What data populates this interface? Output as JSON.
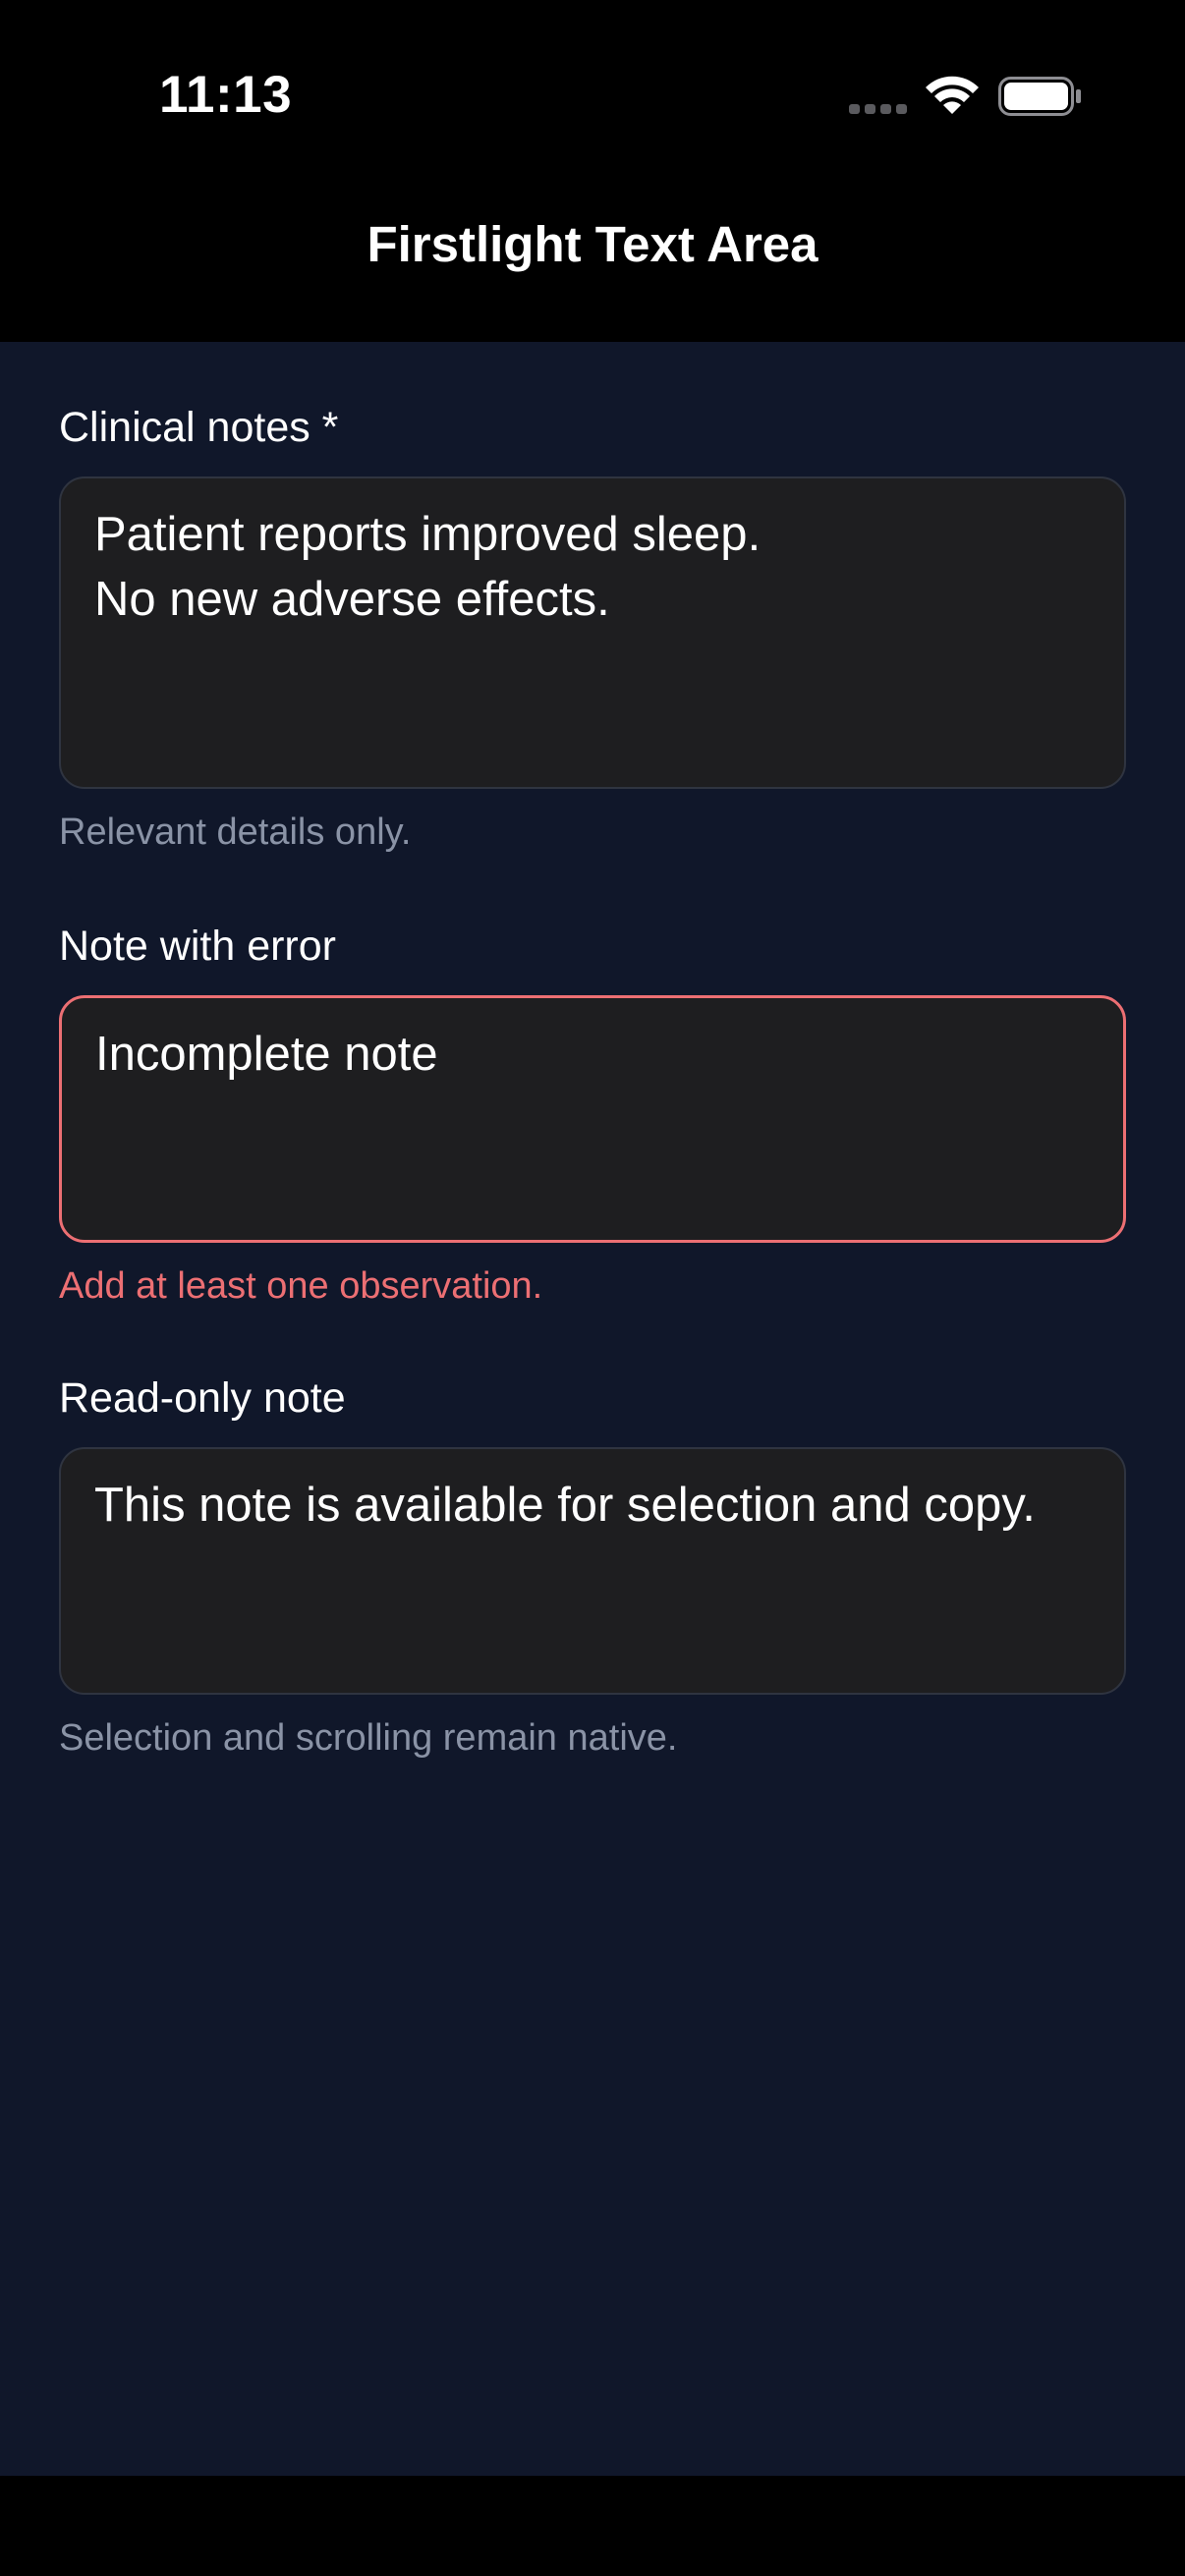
{
  "status_bar": {
    "time": "11:13",
    "icons": [
      "signal-icon",
      "wifi-icon",
      "battery-icon"
    ]
  },
  "nav": {
    "title": "Firstlight Text Area"
  },
  "fields": [
    {
      "label": "Clinical notes *",
      "value": "Patient reports improved sleep.\nNo new adverse effects.",
      "helper": "Relevant details only."
    },
    {
      "label": "Note with error",
      "value": "Incomplete note",
      "helper": "Add at least one observation."
    },
    {
      "label": "Read-only note",
      "value": "This note is available for selection and copy.",
      "helper": "Selection and scrolling remain native."
    }
  ],
  "colors": {
    "background": "#10172a",
    "field_background": "#1e1e20",
    "error": "#ec6f73",
    "helper_text": "#8a93a6"
  }
}
